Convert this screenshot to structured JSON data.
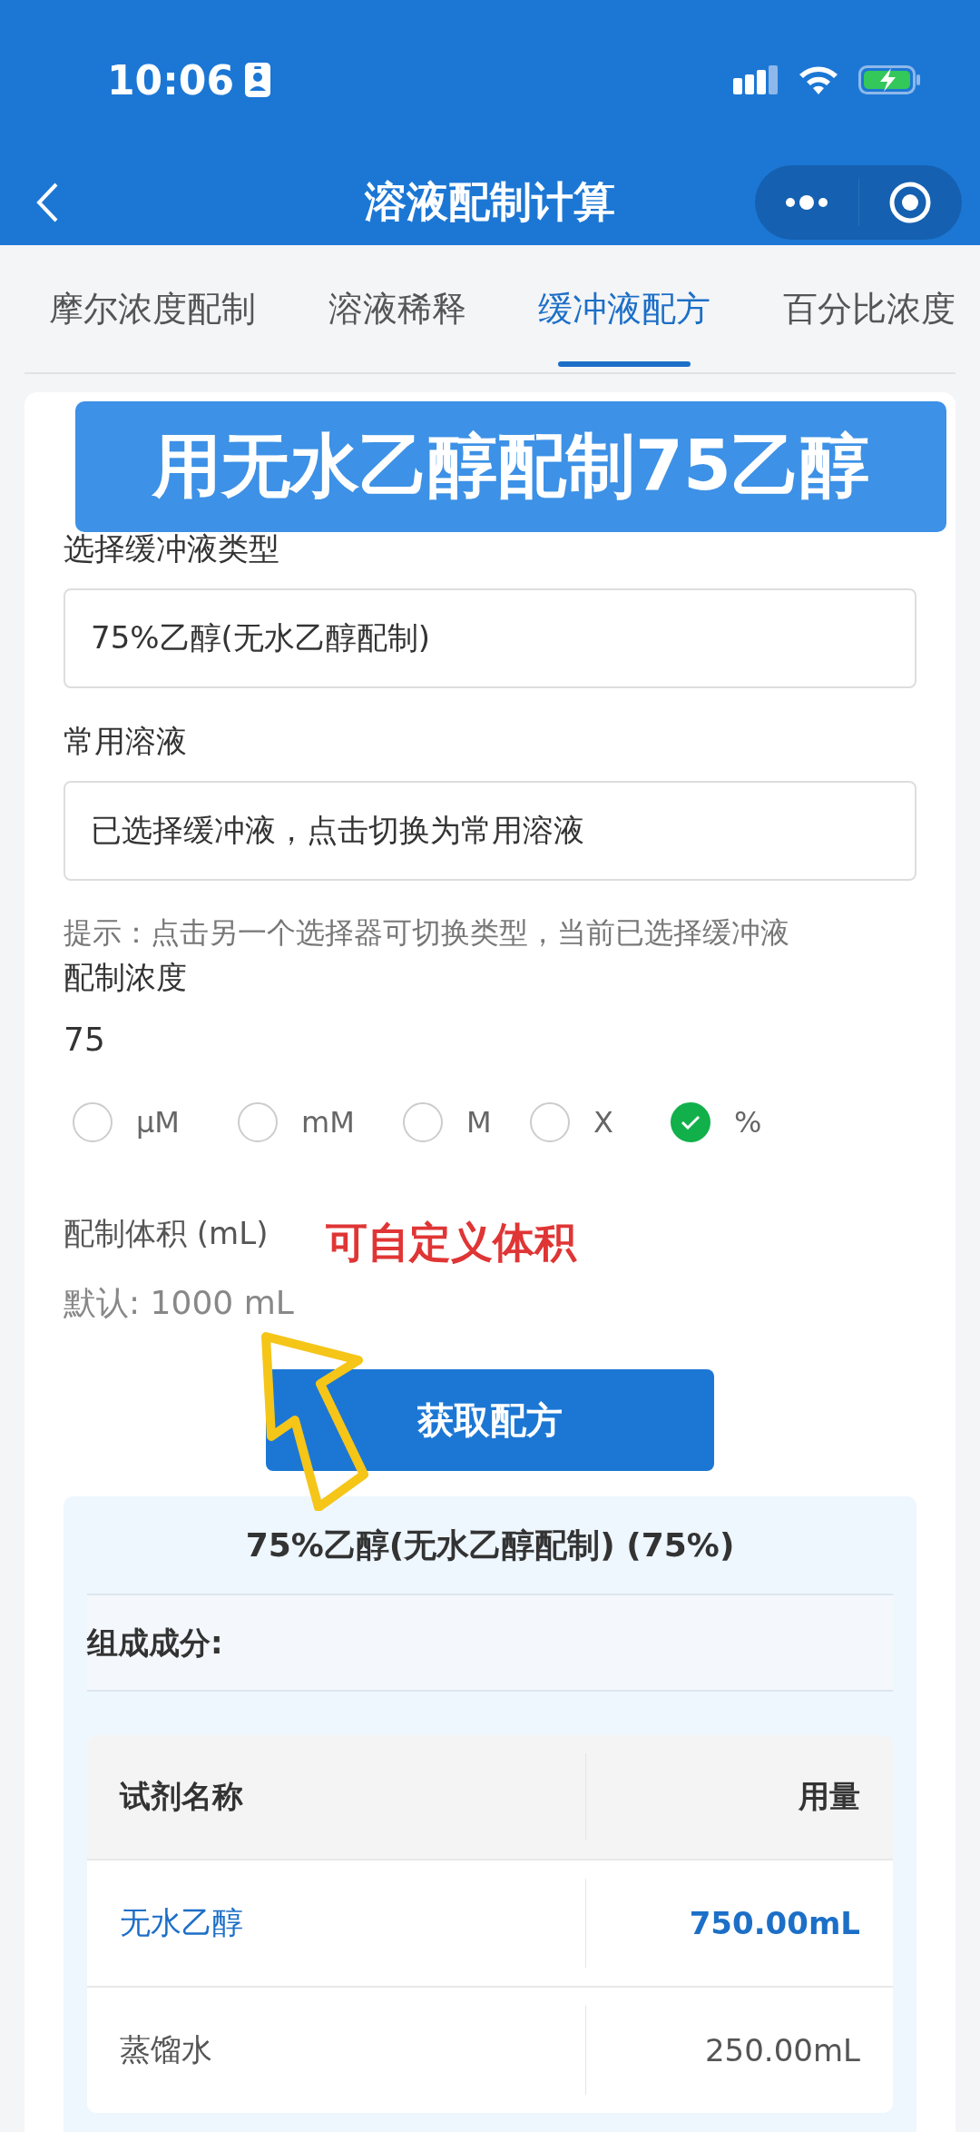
{
  "status_bar": {
    "time": "10:06"
  },
  "nav": {
    "title": "溶液配制计算"
  },
  "tabs": [
    {
      "label": "摩尔浓度配制",
      "selected": false
    },
    {
      "label": "溶液稀释",
      "selected": false
    },
    {
      "label": "缓冲液配方",
      "selected": true
    },
    {
      "label": "百分比浓度",
      "selected": false
    }
  ],
  "banner": {
    "text": "用无水乙醇配制75乙醇"
  },
  "form": {
    "buffer_type": {
      "label": "选择缓冲液类型",
      "value": "75%乙醇(无水乙醇配制)"
    },
    "common_solution": {
      "label": "常用溶液",
      "value": "已选择缓冲液，点击切换为常用溶液"
    },
    "hint": "提示：点击另一个选择器可切换类型，当前已选择缓冲液",
    "concentration": {
      "label": "配制浓度",
      "value": "75"
    },
    "units": [
      {
        "label": "µM",
        "selected": false
      },
      {
        "label": "mM",
        "selected": false
      },
      {
        "label": "M",
        "selected": false
      },
      {
        "label": "X",
        "selected": false
      },
      {
        "label": "%",
        "selected": true
      }
    ],
    "volume": {
      "label": "配制体积 (mL)",
      "placeholder": "默认: 1000 mL"
    },
    "annotation": "可自定义体积",
    "button": "获取配方"
  },
  "result": {
    "title": "75%乙醇(无水乙醇配制) (75%)",
    "section": "组成成分:",
    "columns": [
      "试剂名称",
      "用量"
    ],
    "rows": [
      {
        "name": "无水乙醇",
        "amount": "750.00mL",
        "highlighted": true
      },
      {
        "name": "蒸馏水",
        "amount": "250.00mL",
        "highlighted": false
      }
    ]
  }
}
